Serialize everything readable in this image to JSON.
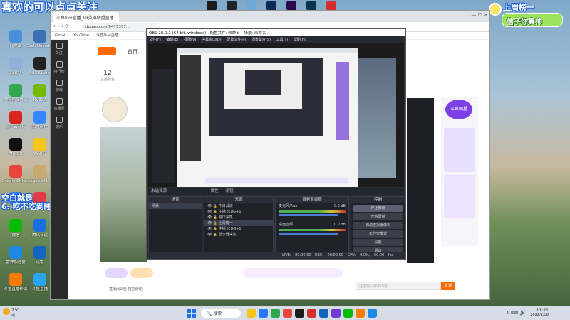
{
  "overlay": {
    "top_danmu": "喜欢的可以点点关注",
    "left_danmu_1": "空白就是",
    "left_danmu_2": "6. 吃不吃到睡眼好",
    "weekly_rank": "上周榜一",
    "weekly_rank_name": "信子你真帅"
  },
  "desktop_icons": [
    {
      "label": "此电脑",
      "color": "#4a90d9"
    },
    {
      "label": "Geek Uninstaller",
      "color": "#3d6fb6"
    },
    {
      "label": "回收站",
      "color": "#8fb0d9"
    },
    {
      "label": "OBS Studio",
      "color": "#222"
    },
    {
      "label": "腾讯电脑管家",
      "color": "#33a853"
    },
    {
      "label": "NVIDIA",
      "color": "#76b900"
    },
    {
      "label": "网易云音乐",
      "color": "#d9261c"
    },
    {
      "label": "百度网盘",
      "color": "#3388ff"
    },
    {
      "label": "腾讯QQ",
      "color": "#111"
    },
    {
      "label": "YY语音",
      "color": "#f5c518"
    },
    {
      "label": "Google Chrome",
      "color": "#e8453c"
    },
    {
      "label": "League of Legends",
      "color": "#c8aa6e"
    },
    {
      "label": "雷神加速器",
      "color": "#2d7ff9"
    },
    {
      "label": "WeGame",
      "color": "#e63946"
    },
    {
      "label": "微信",
      "color": "#09bb07"
    },
    {
      "label": "腾讯会议",
      "color": "#1a6fe0"
    },
    {
      "label": "雷神加速器",
      "color": "#1e88e5"
    },
    {
      "label": "迅雷",
      "color": "#1565c0"
    },
    {
      "label": "斗鱼直播伴侣",
      "color": "#ff7b00"
    },
    {
      "label": "斗鱼直播",
      "color": "#2aa4f4"
    }
  ],
  "top_apps": [
    {
      "name": "tiktok-icon",
      "color": "#1b1b1b"
    },
    {
      "name": "capcut-icon",
      "color": "#222"
    },
    {
      "name": "app-icon",
      "color": "#6fa8dc"
    },
    {
      "name": "photoshop-icon",
      "color": "#0a2a55"
    },
    {
      "name": "premiere-icon",
      "color": "#2a0a4a"
    },
    {
      "name": "audition-icon",
      "color": "#06364a"
    },
    {
      "name": "app-red-icon",
      "color": "#d32f2f"
    }
  ],
  "browser": {
    "tab_label": "斗鱼live直播_lol英雄联盟直播",
    "url": "douyu.com/6475357...",
    "bookmarks": [
      "Gmail",
      "YouTube",
      "斗鱼live直播"
    ],
    "nav_home": "首页",
    "follow_count": "12",
    "follow_label": "主播粉丝",
    "sidebar": [
      "关注",
      "排行榜",
      "游戏",
      "直播间",
      "娱乐"
    ],
    "panel_gift": "开通礼物",
    "chat_placeholder": "这里输入聊天内容",
    "send_btn": "发送",
    "bottom_link": "直播间公告 官方活动",
    "rank_badge": "斗鱼明星",
    "badge_text": "12"
  },
  "obs": {
    "title": "OBS 28.0.2 (64-bit, windows) - 配置文件: 未命名 - 场景: 未命名",
    "menu": [
      "文件(F)",
      "编辑(E)",
      "视图(V)",
      "停靠窗口(D)",
      "配置文件(P)",
      "场景集合(S)",
      "工具(T)",
      "帮助(H)"
    ],
    "no_source": "未选择源",
    "properties_btn": "属性",
    "filters_btn": "滤镜",
    "scenes_header": "场景",
    "scenes": [
      "场景"
    ],
    "sources_header": "来源",
    "sources": [
      "今日战绩",
      "主播 (EDG+1)",
      "窗口采集",
      "上周榜一",
      "主播 (EDG+1)",
      "显示器采集"
    ],
    "mixer_header": "音频混音器",
    "mixer": [
      {
        "name": "麦克风/Aux",
        "db": "0.0 dB"
      },
      {
        "name": "桌面音频",
        "db": "0.0 dB"
      }
    ],
    "controls_header": "控制",
    "controls": [
      "停止推流",
      "开始录制",
      "启动虚拟摄像机",
      "工作室模式",
      "设置",
      "退出"
    ],
    "status": {
      "live": "LIVE: 00:00:00",
      "rec": "REC: 00:00:00",
      "cpu": "CPU: 0.0%, 60.00 fps"
    }
  },
  "taskbar": {
    "weather": "7°C",
    "weather_desc": "晴",
    "search": "搜索",
    "time": "11:21",
    "date": "2022/12/8"
  }
}
